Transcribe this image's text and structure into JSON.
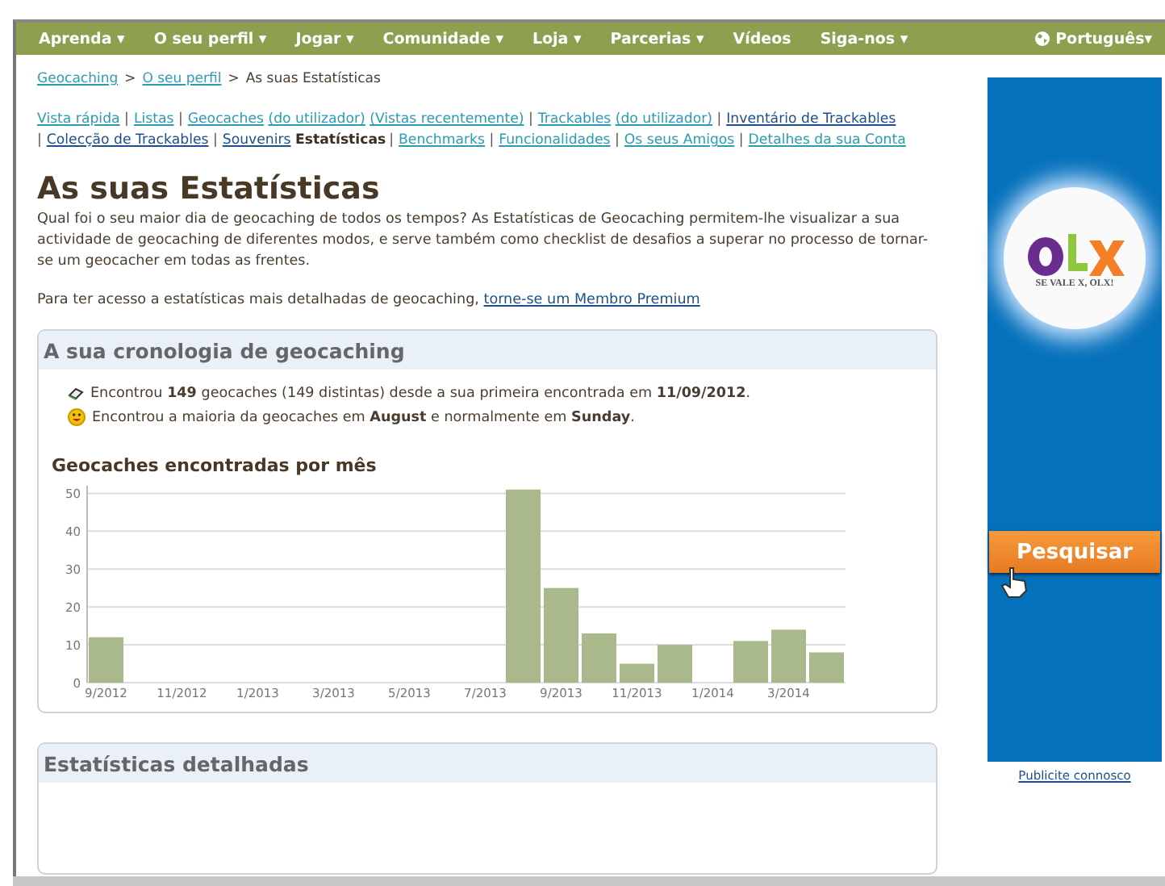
{
  "nav": {
    "items": [
      {
        "label": "Aprenda ▾"
      },
      {
        "label": "O seu perfil ▾"
      },
      {
        "label": "Jogar ▾"
      },
      {
        "label": "Comunidade ▾"
      },
      {
        "label": "Loja ▾"
      },
      {
        "label": "Parcerias ▾"
      },
      {
        "label": "Vídeos"
      },
      {
        "label": "Siga-nos ▾"
      }
    ],
    "language": "Português▾"
  },
  "breadcrumb": [
    {
      "label": "Geocaching",
      "kind": "link"
    },
    {
      "label": ">",
      "kind": "sep"
    },
    {
      "label": "O seu perfil",
      "kind": "link"
    },
    {
      "label": ">",
      "kind": "sep"
    },
    {
      "label": "As suas Estatísticas",
      "kind": "text"
    }
  ],
  "profile_links": [
    {
      "kind": "link",
      "label": "Vista rápida"
    },
    {
      "kind": "sep",
      "label": "|"
    },
    {
      "kind": "link",
      "label": "Listas"
    },
    {
      "kind": "sep",
      "label": "|"
    },
    {
      "kind": "link",
      "label": "Geocaches"
    },
    {
      "kind": "paren",
      "label": "(do utilizador)"
    },
    {
      "kind": "paren",
      "label": "(Vistas recentemente)"
    },
    {
      "kind": "sep",
      "label": "|"
    },
    {
      "kind": "link",
      "label": "Trackables"
    },
    {
      "kind": "paren",
      "label": "(do utilizador)"
    },
    {
      "kind": "sep",
      "label": "|"
    },
    {
      "kind": "visited",
      "label": "Inventário de Trackables"
    },
    {
      "kind": "sep",
      "label": "|"
    },
    {
      "kind": "visited",
      "label": "Colecção de Trackables"
    },
    {
      "kind": "sep",
      "label": "|"
    },
    {
      "kind": "visited",
      "label": "Souvenirs"
    },
    {
      "kind": "current",
      "label": "Estatísticas"
    },
    {
      "kind": "sep",
      "label": "|"
    },
    {
      "kind": "link",
      "label": "Benchmarks"
    },
    {
      "kind": "sep",
      "label": "|"
    },
    {
      "kind": "link",
      "label": "Funcionalidades"
    },
    {
      "kind": "sep",
      "label": "|"
    },
    {
      "kind": "link",
      "label": "Os seus Amigos"
    },
    {
      "kind": "sep",
      "label": "|"
    },
    {
      "kind": "link",
      "label": "Detalhes da sua Conta"
    }
  ],
  "title": "As suas Estatísticas",
  "intro": "Qual foi o seu maior dia de geocaching de todos os tempos? As Estatísticas de Geocaching permitem-lhe visualizar a sua actividade de geocaching de diferentes modos, e serve também como checklist de desafios a superar no processo de tornar-se um geocacher em todas as frentes.",
  "premium": {
    "text": "Para ter acesso a estatísticas mais detalhadas de geocaching,",
    "link": "torne-se um Membro Premium"
  },
  "timeline": {
    "heading": "A sua cronologia de geocaching",
    "facts": [
      {
        "kind": "finds",
        "text": "Encontrou **149** geocaches (149 distintas) desde a sua primeira encontrada em **11/09/2012**."
      },
      {
        "kind": "smiley",
        "text": "Encontrou a maioria da geocaches em **August** e normalmente em **Sunday**."
      }
    ],
    "chart_data": {
      "type": "bar",
      "title": "Geocaches encontradas por mês",
      "categories": [
        "9/2012",
        null,
        "11/2012",
        null,
        "1/2013",
        null,
        "3/2013",
        null,
        "5/2013",
        null,
        "7/2013",
        null,
        "9/2013",
        null,
        "11/2013",
        null,
        "1/2014",
        null,
        "3/2014",
        null
      ],
      "series": [
        {
          "color": "#a9b98c",
          "values": [
            12,
            0,
            0,
            0,
            0,
            0,
            0,
            0,
            0,
            0,
            0,
            51,
            25,
            13,
            5,
            10,
            0,
            11,
            14,
            8
          ]
        }
      ],
      "ylim": [
        0,
        52
      ],
      "yticks": [
        0,
        10,
        20,
        30,
        40,
        50
      ],
      "grid": true
    }
  },
  "detailed": {
    "heading": "Estatísticas detalhadas"
  },
  "ad": {
    "tagline": "SE VALE X, OLX!",
    "button": "Pesquisar",
    "footer": "Publicite connosco"
  }
}
